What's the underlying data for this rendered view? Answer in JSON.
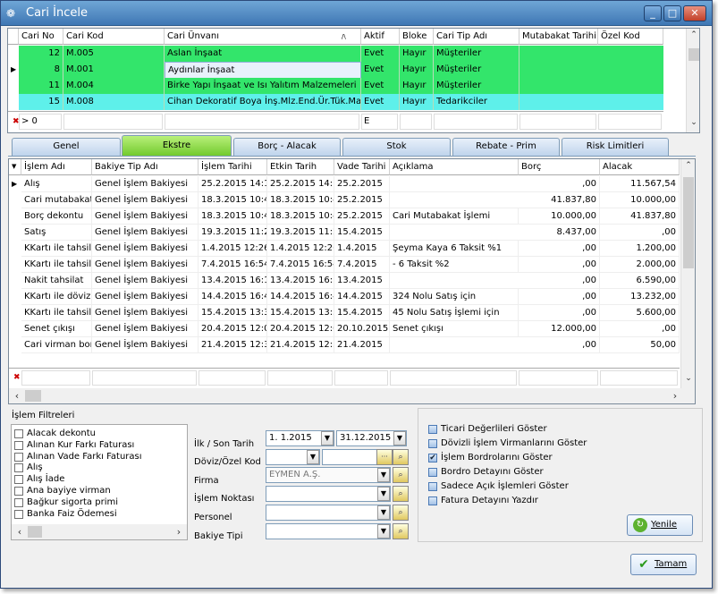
{
  "window": {
    "title": "Cari İncele",
    "minimize": "_",
    "maximize": "□",
    "close": "✕"
  },
  "top_grid": {
    "columns": [
      "Cari No",
      "Cari Kod",
      "Cari Ünvanı",
      "Aktif",
      "Bloke",
      "Cari Tip Adı",
      "Mutabakat Tarihi",
      "Özel Kod"
    ],
    "rows": [
      {
        "no": "12",
        "kod": "M.005",
        "unvan": "Aslan İnşaat",
        "aktif": "Evet",
        "bloke": "Hayır",
        "tip": "Müşteriler",
        "color": "#33e56b"
      },
      {
        "no": "8",
        "kod": "M.001",
        "unvan": "Aydınlar İnşaat",
        "aktif": "Evet",
        "bloke": "Hayır",
        "tip": "Müşteriler",
        "color": "#33e56b"
      },
      {
        "no": "11",
        "kod": "M.004",
        "unvan": "Birke Yapı İnşaat ve Isı Yalıtım Malzemeleri",
        "aktif": "Evet",
        "bloke": "Hayır",
        "tip": "Müşteriler",
        "color": "#33e56b"
      },
      {
        "no": "15",
        "kod": "M.008",
        "unvan": "Cihan Dekoratif Boya İnş.Mlz.End.Ür.Tük.Mal.",
        "aktif": "Evet",
        "bloke": "Hayır",
        "tip": "Tedarikciler",
        "color": "#5ef0ea"
      }
    ],
    "filter_row": {
      "no": "> 0",
      "aktif": "E"
    },
    "sort_marker": "/\\"
  },
  "tabs": [
    "Genel",
    "Ekstre",
    "Borç - Alacak",
    "Stok",
    "Rebate - Prim",
    "Risk Limitleri"
  ],
  "active_tab": "Ekstre",
  "bottom_grid": {
    "columns": [
      "İşlem Adı",
      "Bakiye Tip Adı",
      "İşlem Tarihi",
      "Etkin Tarih",
      "Vade Tarihi",
      "Açıklama",
      "Borç",
      "Alacak"
    ],
    "rows": [
      {
        "islem": "Alış",
        "bakiye": "Genel İşlem Bakiyesi",
        "islem_tarihi": "25.2.2015 14:1",
        "etkin": "25.2.2015 14:1",
        "vade": "25.2.2015",
        "aciklama": "",
        "borc": ",00",
        "alacak": "11.567,54"
      },
      {
        "islem": "Cari mutabakat",
        "bakiye": "Genel İşlem Bakiyesi",
        "islem_tarihi": "18.3.2015 10:4",
        "etkin": "18.3.2015 10:4",
        "vade": "25.2.2015",
        "aciklama": "",
        "borc": "41.837,80",
        "alacak": "10.000,00"
      },
      {
        "islem": "Borç dekontu",
        "bakiye": "Genel İşlem Bakiyesi",
        "islem_tarihi": "18.3.2015 10:4",
        "etkin": "18.3.2015 10:4",
        "vade": "25.2.2015",
        "aciklama": "Cari Mutabakat İşlemi",
        "borc": "10.000,00",
        "alacak": "41.837,80"
      },
      {
        "islem": "Satış",
        "bakiye": "Genel İşlem Bakiyesi",
        "islem_tarihi": "19.3.2015 11:2",
        "etkin": "19.3.2015 11:2",
        "vade": "15.4.2015",
        "aciklama": "",
        "borc": "8.437,00",
        "alacak": ",00"
      },
      {
        "islem": "KKartı ile tahsila",
        "bakiye": "Genel İşlem Bakiyesi",
        "islem_tarihi": "1.4.2015 12:26",
        "etkin": "1.4.2015 12:26",
        "vade": "1.4.2015",
        "aciklama": "Şeyma Kaya  6 Taksit %1",
        "borc": ",00",
        "alacak": "1.200,00"
      },
      {
        "islem": "KKartı ile tahsila",
        "bakiye": "Genel İşlem Bakiyesi",
        "islem_tarihi": "7.4.2015 16:54",
        "etkin": "7.4.2015 16:54",
        "vade": "7.4.2015",
        "aciklama": " -  6 Taksit %2",
        "borc": ",00",
        "alacak": "2.000,00"
      },
      {
        "islem": "Nakit tahsilat",
        "bakiye": "Genel İşlem Bakiyesi",
        "islem_tarihi": "13.4.2015 16:1",
        "etkin": "13.4.2015 16:1",
        "vade": "13.4.2015",
        "aciklama": "",
        "borc": ",00",
        "alacak": "6.590,00"
      },
      {
        "islem": "KKartı ile dövizl",
        "bakiye": "Genel İşlem Bakiyesi",
        "islem_tarihi": "14.4.2015 16:4",
        "etkin": "14.4.2015 16:4",
        "vade": "14.4.2015",
        "aciklama": "324 Nolu Satış için",
        "borc": ",00",
        "alacak": "13.232,00"
      },
      {
        "islem": "KKartı ile tahsila",
        "bakiye": "Genel İşlem Bakiyesi",
        "islem_tarihi": "15.4.2015 13:3",
        "etkin": "15.4.2015 13:3",
        "vade": "15.4.2015",
        "aciklama": "45 Nolu Satış İşlemi için",
        "borc": ",00",
        "alacak": "5.600,00"
      },
      {
        "islem": "Senet çıkışı",
        "bakiye": "Genel İşlem Bakiyesi",
        "islem_tarihi": "20.4.2015 12:0",
        "etkin": "20.4.2015 12:0",
        "vade": "20.10.2015",
        "aciklama": "Senet çıkışı",
        "borc": "12.000,00",
        "alacak": ",00"
      },
      {
        "islem": "Cari virman borc",
        "bakiye": "Genel İşlem Bakiyesi",
        "islem_tarihi": "21.4.2015 12:3",
        "etkin": "21.4.2015 12:3",
        "vade": "21.4.2015",
        "aciklama": "",
        "borc": ",00",
        "alacak": "50,00"
      }
    ]
  },
  "filters": {
    "title": "İşlem Filtreleri",
    "items": [
      "Alacak dekontu",
      "Alınan Kur Farkı Faturası",
      "Alınan Vade Farkı Faturası",
      "Alış",
      "Alış İade",
      "Ana bayiye virman",
      "Bağkur sigorta primi",
      "Banka Faiz Ödemesi"
    ]
  },
  "form": {
    "ilk_son_label": "İlk / Son Tarih",
    "ilk_tarih": " 1.  1.2015",
    "son_tarih": "31.12.2015",
    "doviz_label": "Döviz/Özel Kod",
    "firma_label": "Firma",
    "firma_value": "EYMEN A.Ş.",
    "islem_noktasi_label": "İşlem Noktası",
    "personel_label": "Personel",
    "bakiye_tipi_label": "Bakiye Tipi",
    "ellipsis": "···"
  },
  "options": [
    {
      "label": "Ticari Değerlileri Göster",
      "checked": false
    },
    {
      "label": "Dövizli İşlem Virmanlarını Göster",
      "checked": false
    },
    {
      "label": "İşlem Bordrolarını Göster",
      "checked": true
    },
    {
      "label": "Bordro Detayını Göster",
      "checked": false
    },
    {
      "label": "Sadece Açık İşlemleri Göster",
      "checked": false
    },
    {
      "label": "Fatura Detayını Yazdır",
      "checked": false
    }
  ],
  "buttons": {
    "yenile": "Yenile",
    "tamam": "Tamam"
  }
}
